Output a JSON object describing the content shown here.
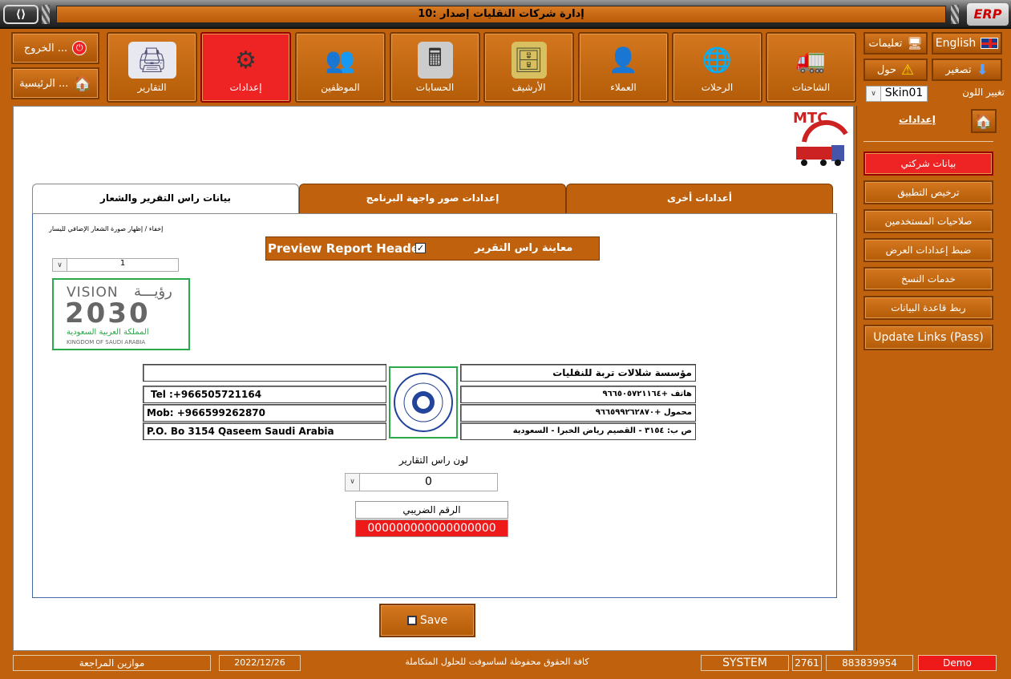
{
  "window": {
    "title": "إدارة شركات النقليات إصدار :10",
    "brand": "ERP"
  },
  "toolbar": {
    "exit_label": "الخروج ...",
    "home_label": "الرئيسية ...",
    "modules": [
      {
        "label": "التقارير",
        "icon": "printer-icon"
      },
      {
        "label": "إعدادات",
        "icon": "gears-icon"
      },
      {
        "label": "الموظفين",
        "icon": "employees-icon"
      },
      {
        "label": "الحسابات",
        "icon": "calculator-icon"
      },
      {
        "label": "الأرشيف",
        "icon": "archive-icon"
      },
      {
        "label": "العملاء",
        "icon": "clients-icon"
      },
      {
        "label": "الرحلات",
        "icon": "globe-icon"
      },
      {
        "label": "الشاحنات",
        "icon": "truck-icon"
      }
    ],
    "instructions_label": "تعليمات",
    "language_label": "English",
    "about_label": "حول",
    "minimize_label": "تصغير",
    "change_color_label": "تغيير اللون",
    "skin_value": "Skin01"
  },
  "sidebar": {
    "title": "إعدادات",
    "items": [
      "بيانات شركتي",
      "ترخيص التطبيق",
      "صلاحيات المستخدمين",
      "ضبط إعدادات العرض",
      "خدمات النسخ",
      "ربط قاعدة البيانات",
      "Update Links (Pass)"
    ]
  },
  "mtc_logo": "MTC",
  "tabs": [
    "بيانات راس التقرير والشعار",
    "إعدادات صور واجهة البرنامج",
    "أعدادات أخرى"
  ],
  "panel": {
    "hide_show_logo_label": "إخفاء / إظهار صورة الشعار الإضافي لليسار",
    "logo_combo_value": "1",
    "vision_logo": {
      "line1": "VISION",
      "line1_ar": "رؤيـــة",
      "year": "2030",
      "ar_kingdom": "المملكة العربية السعودية",
      "en_kingdom": "KINGDOM OF SAUDI ARABIA"
    },
    "preview_checkbox_label": "Preview Report Header",
    "preview_checkbox_label_ar": "معاينة راس التقرير",
    "left_info": [
      "",
      "Tel :+966505721164",
      "Mob: +966599262870",
      "P.O. Bo 3154 Qaseem Saudi Arabia"
    ],
    "right_info": [
      "مؤسسة شلالات تربة للنقليات",
      "هاتف +٩٦٦٥٠٥٧٢١١٦٤",
      "محمول +٩٦٦٥٩٩٢٦٢٨٧٠",
      "ص ب: ٣١٥٤ - القصيم رياض الخبرا - السعودية"
    ],
    "header_color_label": "لون راس التقارير",
    "header_color_value": "0",
    "tax_number_label": "الرقم الضريبي",
    "tax_number_value": "000000000000000000",
    "save_label": "Save"
  },
  "status": {
    "left_item": "موازين المراجعة",
    "date": "2022/12/26",
    "copyright": "كافة الحقوق محفوظة لساسوفت للحلول المتكاملة",
    "user": "SYSTEM",
    "code": "2761",
    "serial": "883839954",
    "mode": "Demo"
  },
  "colors": {
    "accent": "#c0620d",
    "active": "#ee2424",
    "green_border": "#2aa84a"
  }
}
